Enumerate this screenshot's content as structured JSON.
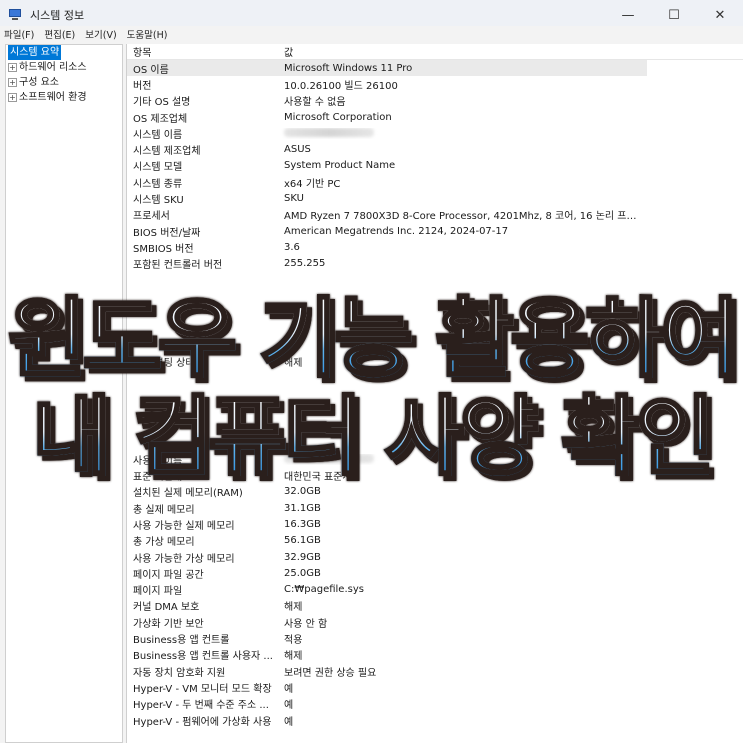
{
  "window": {
    "title": "시스템 정보",
    "controls": {
      "minimize": "—",
      "maximize": "☐",
      "close": "✕"
    }
  },
  "menu": [
    "파일(F)",
    "편집(E)",
    "보기(V)",
    "도움말(H)"
  ],
  "tree": [
    {
      "label": "시스템 요약",
      "selected": true,
      "expander": false
    },
    {
      "label": "하드웨어 리소스",
      "selected": false,
      "expander": true
    },
    {
      "label": "구성 요소",
      "selected": false,
      "expander": true
    },
    {
      "label": "소프트웨어 환경",
      "selected": false,
      "expander": true
    }
  ],
  "table": {
    "headers": {
      "item": "항목",
      "value": "값"
    },
    "rows": [
      {
        "item": "OS 이름",
        "value": "Microsoft Windows 11 Pro",
        "highlight": true
      },
      {
        "item": "버전",
        "value": "10.0.26100 빌드 26100"
      },
      {
        "item": "기타 OS 설명",
        "value": "사용할 수 없음"
      },
      {
        "item": "OS 제조업체",
        "value": "Microsoft Corporation"
      },
      {
        "item": "시스템 이름",
        "value": "",
        "blurred": true
      },
      {
        "item": "시스템 제조업체",
        "value": "ASUS"
      },
      {
        "item": "시스템 모델",
        "value": "System Product Name"
      },
      {
        "item": "시스템 종류",
        "value": "x64 기반 PC"
      },
      {
        "item": "시스템 SKU",
        "value": "SKU"
      },
      {
        "item": "프로세서",
        "value": "AMD Ryzen 7 7800X3D 8-Core Processor, 4201Mhz, 8 코어, 16 논리 프로세..."
      },
      {
        "item": "BIOS 버전/날짜",
        "value": "American Megatrends Inc. 2124, 2024-07-17"
      },
      {
        "item": "SMBIOS 버전",
        "value": "3.6"
      },
      {
        "item": "포함된 컨트롤러 버전",
        "value": "255.255"
      },
      {
        "item": "",
        "value": ""
      },
      {
        "item": "",
        "value": ""
      },
      {
        "item": "",
        "value": ""
      },
      {
        "item": "",
        "value": ""
      },
      {
        "item": "",
        "value": ""
      },
      {
        "item": "보안 부팅 상태",
        "value": "해제"
      },
      {
        "item": "",
        "value": ""
      },
      {
        "item": "",
        "value": ""
      },
      {
        "item": "",
        "value": ""
      },
      {
        "item": "",
        "value": ""
      },
      {
        "item": "",
        "value": ""
      },
      {
        "item": "사용자 이름",
        "value": "",
        "blurred": true
      },
      {
        "item": "표준 시간대",
        "value": "대한민국 표준시"
      },
      {
        "item": "설치된 실제 메모리(RAM)",
        "value": "32.0GB"
      },
      {
        "item": "총 실제 메모리",
        "value": "31.1GB"
      },
      {
        "item": "사용 가능한 실제 메모리",
        "value": "16.3GB"
      },
      {
        "item": "총 가상 메모리",
        "value": "56.1GB"
      },
      {
        "item": "사용 가능한 가상 메모리",
        "value": "32.9GB"
      },
      {
        "item": "페이지 파일 공간",
        "value": "25.0GB"
      },
      {
        "item": "페이지 파일",
        "value": "C:₩pagefile.sys"
      },
      {
        "item": "커널 DMA 보호",
        "value": "해제"
      },
      {
        "item": "가상화 기반 보안",
        "value": "사용 안 함"
      },
      {
        "item": "Business용 앱 컨트롤",
        "value": "적용"
      },
      {
        "item": "Business용 앱 컨트롤 사용자 ...",
        "value": "해제"
      },
      {
        "item": "자동 장치 암호화 지원",
        "value": "보려면 권한 상승 필요"
      },
      {
        "item": "Hyper-V - VM 모니터 모드 확장",
        "value": "예"
      },
      {
        "item": "Hyper-V - 두 번째 수준 주소 ...",
        "value": "예"
      },
      {
        "item": "Hyper-V - 펌웨어에 가상화 사용",
        "value": "예"
      }
    ]
  },
  "overlay": {
    "line1": "윈도우 기능 활용하여",
    "line2": "내 컴퓨터 사양 확인"
  }
}
